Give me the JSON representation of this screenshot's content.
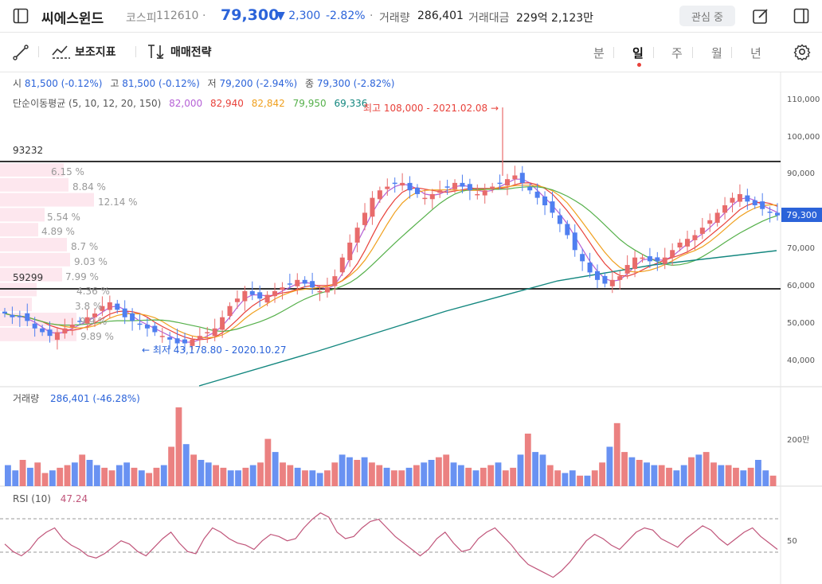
{
  "header": {
    "name": "씨에스윈드",
    "market": "코스피",
    "code": "112610",
    "price": "79,300",
    "change": "▼ 2,300",
    "change_pct": "-2.82%",
    "volume_label": "거래량",
    "volume": "286,401",
    "amount_label": "거래대금",
    "amount": "229억 2,123만",
    "interest_button": "관심 중"
  },
  "toolbar": {
    "indicator_label": "보조지표",
    "strategy_label": "매매전략",
    "periods": [
      "분",
      "일",
      "주",
      "월",
      "년"
    ],
    "active_period": "일"
  },
  "ohlc": {
    "open_label": "시",
    "open": "81,500 (-0.12%)",
    "high_label": "고",
    "high": "81,500 (-0.12%)",
    "low_label": "저",
    "low": "79,200 (-2.94%)",
    "close_label": "종",
    "close": "79,300 (-2.82%)"
  },
  "ma": {
    "label": "단순이동평균 (5, 10, 12, 20, 150)",
    "values": [
      "82,000",
      "82,940",
      "82,842",
      "79,950",
      "69,336"
    ],
    "colors": [
      "#b661d6",
      "#e8413a",
      "#f0a01e",
      "#55b04a",
      "#13877f"
    ]
  },
  "annotations": {
    "max_label": "최고 108,000 - 2021.02.08",
    "min_label": "최저 43,178.80 - 2020.10.27",
    "hline_upper": "93232",
    "hline_lower": "59299"
  },
  "volume_profile": [
    "6.15 %",
    "8.84 %",
    "12.14 %",
    "5.54 %",
    "4.89 %",
    "8.7 %",
    "9.03 %",
    "7.99 %",
    "4.36 %",
    "3.8 %",
    "9.9 %",
    "9.89 %"
  ],
  "price_axis": [
    "110,000",
    "100,000",
    "90,000",
    "70,000",
    "60,000",
    "50,000",
    "40,000"
  ],
  "current_price_tag": "79,300",
  "volume_panel": {
    "label": "거래량",
    "value": "286,401 (-46.28%)",
    "axis": "200만"
  },
  "rsi_panel": {
    "label": "RSI (10)",
    "value": "47.24",
    "axis": "50"
  },
  "colors": {
    "up": "#e86b6b",
    "down": "#4f7ff0",
    "accent": "#2b63d9"
  },
  "chart_data": {
    "type": "candlestick",
    "ylim": [
      35000,
      112000
    ],
    "series_close": [
      53,
      52,
      52,
      51,
      49,
      48,
      47,
      48,
      49,
      50,
      51,
      52,
      53,
      55,
      56,
      54,
      52,
      51,
      50,
      49,
      48,
      47,
      46,
      45,
      45,
      46,
      47,
      48,
      49,
      52,
      55,
      57,
      59,
      58,
      57,
      58,
      59,
      60,
      61,
      62,
      61,
      60,
      59,
      60,
      63,
      68,
      72,
      76,
      80,
      84,
      86,
      87,
      88,
      88,
      86,
      85,
      84,
      85,
      86,
      87,
      88,
      87,
      86,
      85,
      86,
      87,
      88,
      89,
      90,
      88,
      86,
      84,
      82,
      80,
      77,
      74,
      70,
      67,
      64,
      62,
      61,
      62,
      63,
      66,
      68,
      68,
      67,
      67,
      68,
      70,
      72,
      73,
      74,
      76,
      78,
      80,
      82,
      84,
      85,
      83,
      82,
      81,
      80,
      79.3
    ],
    "volume": [
      80,
      60,
      100,
      70,
      90,
      50,
      60,
      70,
      80,
      90,
      120,
      100,
      80,
      70,
      60,
      80,
      90,
      70,
      60,
      50,
      70,
      80,
      150,
      300,
      160,
      120,
      100,
      90,
      80,
      70,
      60,
      60,
      70,
      80,
      90,
      180,
      130,
      90,
      80,
      70,
      60,
      60,
      50,
      60,
      90,
      120,
      110,
      100,
      110,
      90,
      80,
      70,
      60,
      60,
      70,
      80,
      90,
      100,
      110,
      120,
      90,
      80,
      70,
      60,
      70,
      80,
      90,
      60,
      70,
      120,
      200,
      130,
      120,
      80,
      60,
      50,
      60,
      40,
      40,
      60,
      90,
      150,
      240,
      130,
      110,
      100,
      90,
      80,
      80,
      70,
      60,
      80,
      110,
      120,
      130,
      90,
      80,
      80,
      70,
      60,
      70,
      100,
      60,
      40
    ],
    "rsi": [
      55,
      48,
      44,
      50,
      60,
      66,
      70,
      60,
      54,
      50,
      44,
      42,
      46,
      52,
      58,
      55,
      48,
      44,
      52,
      60,
      66,
      56,
      48,
      46,
      60,
      70,
      66,
      60,
      56,
      54,
      50,
      58,
      64,
      62,
      58,
      60,
      70,
      78,
      84,
      80,
      66,
      60,
      62,
      70,
      76,
      78,
      70,
      62,
      56,
      50,
      44,
      50,
      60,
      66,
      56,
      48,
      50,
      60,
      66,
      70,
      62,
      54,
      44,
      36,
      32,
      28,
      24,
      30,
      38,
      48,
      58,
      64,
      60,
      54,
      50,
      58,
      66,
      70,
      68,
      60,
      56,
      52,
      60,
      66,
      72,
      68,
      60,
      54,
      60,
      66,
      70,
      62,
      56,
      50
    ]
  }
}
